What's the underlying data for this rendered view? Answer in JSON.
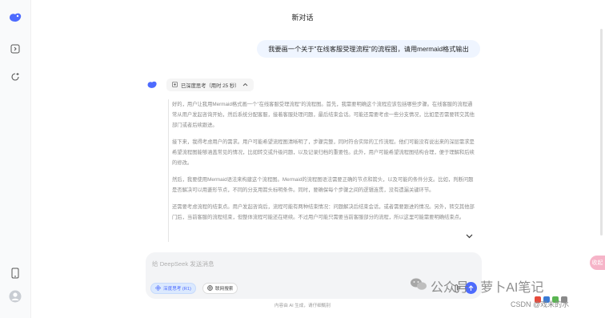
{
  "page": {
    "title": "新对话",
    "footer": "内容由 AI 生成，请仔细甄别"
  },
  "sidebar": {
    "icons": [
      "deepseek-logo-icon",
      "sidebar-toggle-icon",
      "new-chat-icon",
      "phone-icon",
      "user-avatar-icon"
    ]
  },
  "conversation": {
    "user_message": "我要画一个关于\"在线客服受理流程\"的流程图，请用mermaid格式输出",
    "think_chip": {
      "label": "已深度思考（用时 25 秒）"
    },
    "reasoning": [
      "好的，用户让我用Mermaid格式画一个\"在线客服受理流程\"的流程图。首先，我需要明确这个流程应该包括哪些步骤。在线客服的流程通常从用户发起咨询开始，然后系统分配客服，接着客服处理问题，最后结束会话。可能还需要考虑一些分支情况，比如是否需要转交其他部门或者后续跟进。",
      "接下来，我得考虑用户的需求。用户可能希望流程图清晰明了，步骤完整，同时符合实际的工作流程。他们可能没有说出来的深层需求是希望流程图能够涵盖常见的情况，比如转交或升级问题，以及记录归档的重要性。此外，用户可能希望流程图结构合理，便于理解和后续的修改。",
      "然后，我要使用Mermaid语法来构建这个流程图。Mermaid的流程图语法需要正确的节点和箭头，以及可能的条件分支。比如，判断问题是否解决可以用菱形节点，不同的分支用箭头标明条件。同时，要确保每个步骤之间的逻辑连贯，没有遗漏关键环节。",
      "还需要考虑流程的结束点。用户发起咨询后，流程可能有两种结束情况：问题解决后结束会话，或者需要跟进的情况。另外，转交其他部门后，当前客服的流程结束，但整体流程可能还在继续。不过用户可能只需要当前客服部分的流程，所以这里可能需要明确结束点。"
    ]
  },
  "input": {
    "placeholder": "给 DeepSeek 发送消息",
    "deep_think_label": "深度思考 (R1)",
    "web_search_label": "联网搜索"
  },
  "overlay": {
    "watermark_text": "公众号 · 萝卜AI笔记",
    "csdn_text": "CSDN @戏未的水",
    "float_label": "收起"
  },
  "colors": {
    "accent": "#4d6bfe",
    "user_bubble": "#eff5ff"
  }
}
